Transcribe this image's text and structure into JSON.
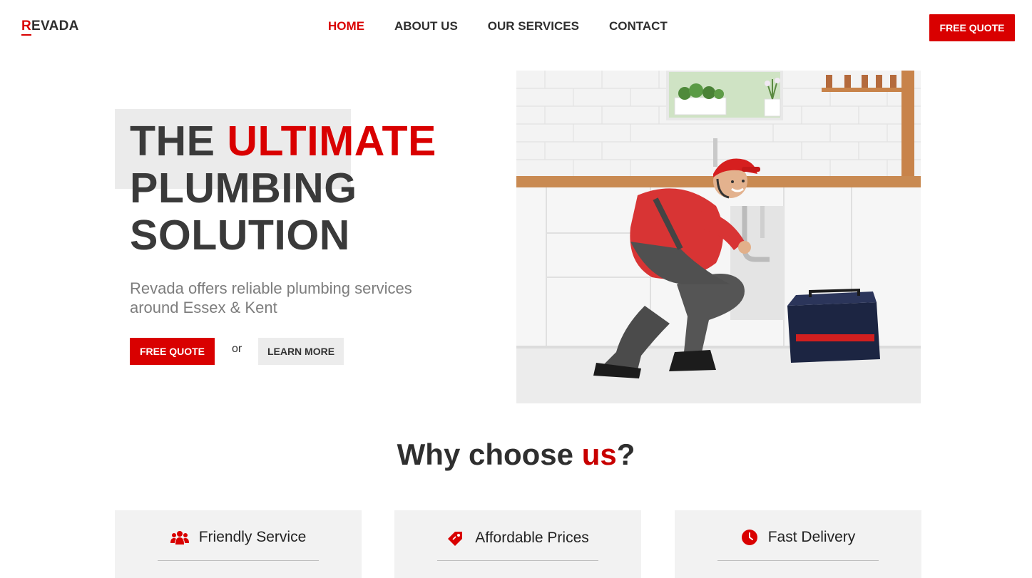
{
  "brand": {
    "first_letter": "R",
    "rest": "EVADA"
  },
  "nav": {
    "items": [
      {
        "label": "HOME",
        "active": true
      },
      {
        "label": "ABOUT US",
        "active": false
      },
      {
        "label": "OUR SERVICES",
        "active": false
      },
      {
        "label": "CONTACT",
        "active": false
      }
    ],
    "cta_label": "FREE QUOTE"
  },
  "hero": {
    "title_part1": "THE ",
    "title_accent": "ULTIMATE",
    "title_line2": "PLUMBING",
    "title_line3": "SOLUTION",
    "subtitle": "Revada offers reliable plumbing services around Essex & Kent",
    "primary_button": "FREE QUOTE",
    "or_text": "or",
    "secondary_button": "LEARN MORE"
  },
  "why": {
    "title_part1": "Why choose ",
    "title_accent": "us",
    "title_end": "?"
  },
  "features": [
    {
      "label": "Friendly Service",
      "icon": "users-icon"
    },
    {
      "label": "Affordable Prices",
      "icon": "price-tag-icon"
    },
    {
      "label": "Fast Delivery",
      "icon": "clock-icon"
    }
  ],
  "colors": {
    "accent": "#d90000",
    "text": "#333333",
    "card_bg": "#f2f2f2"
  }
}
